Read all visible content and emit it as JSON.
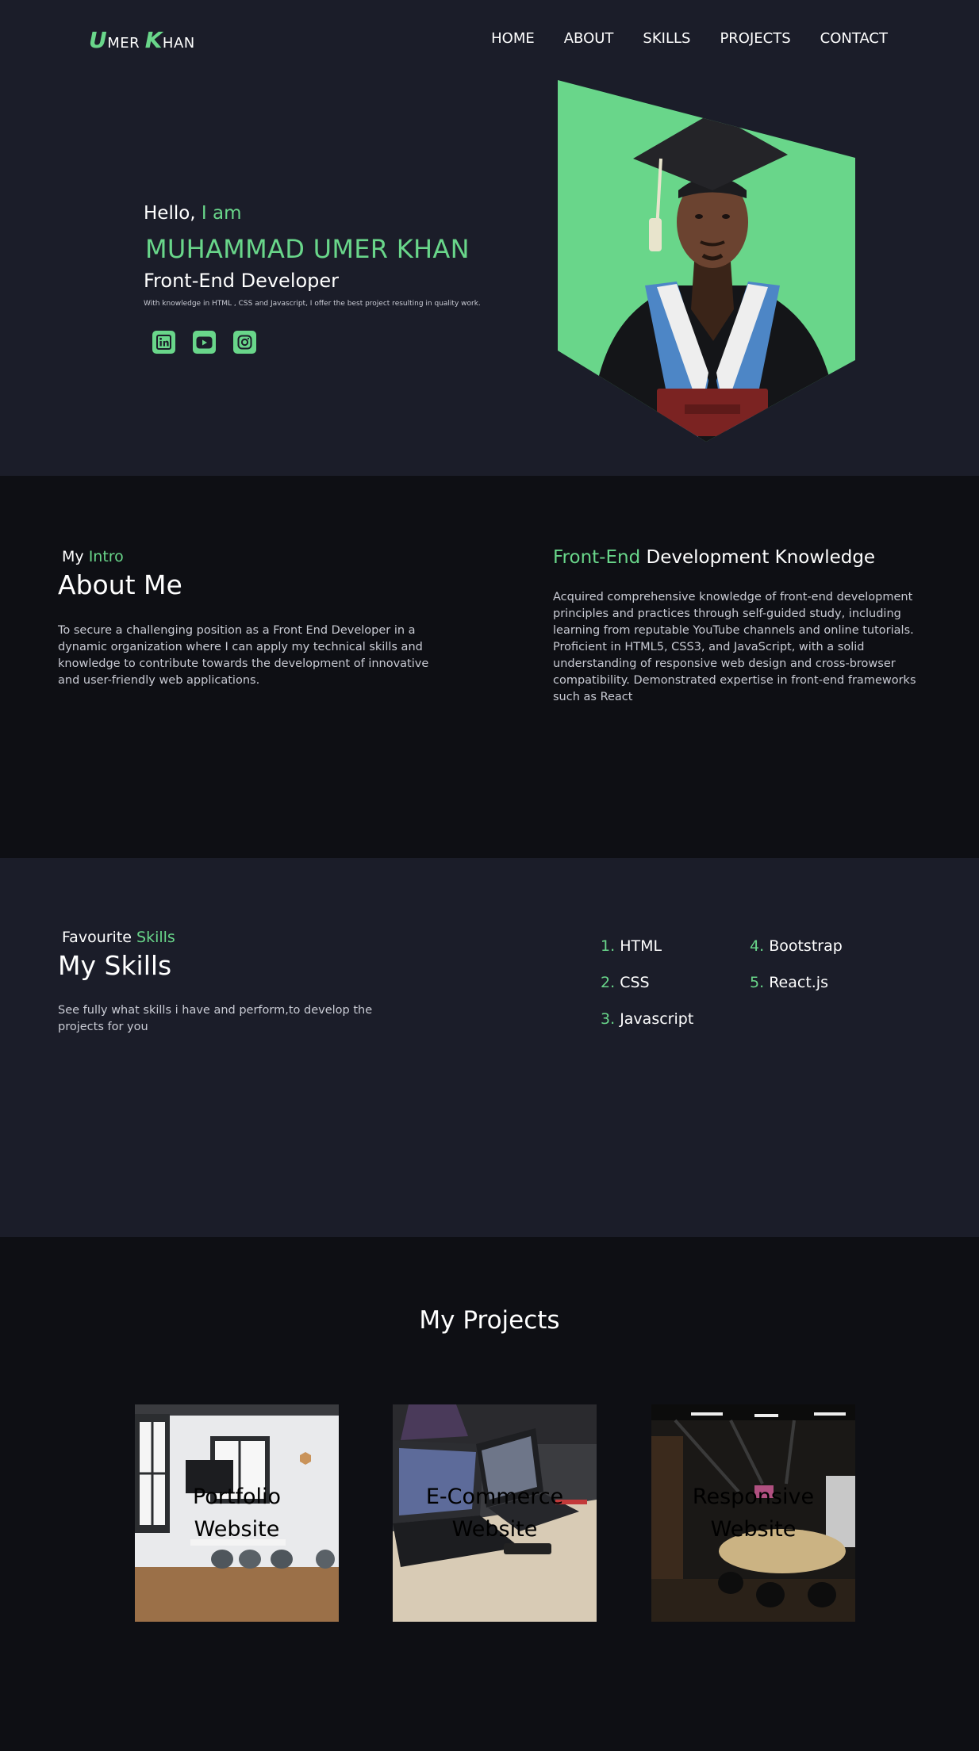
{
  "nav": {
    "logo": {
      "first_cap": "U",
      "first_rest": "MER",
      "second_cap": "K",
      "second_rest": "HAN"
    },
    "items": [
      {
        "label": "HOME"
      },
      {
        "label": "ABOUT"
      },
      {
        "label": "SKILLS"
      },
      {
        "label": "PROJECTS"
      },
      {
        "label": "CONTACT"
      }
    ]
  },
  "hero": {
    "hello": "Hello,",
    "iam": "I am",
    "name": "MUHAMMAD UMER KHAN",
    "role": "Front-End Developer",
    "blurb": "With knowledge in HTML , CSS and Javascript, I offer the best project resulting in quality work.",
    "socials": [
      {
        "icon": "linkedin-icon"
      },
      {
        "icon": "youtube-icon"
      },
      {
        "icon": "instagram-icon"
      }
    ]
  },
  "about": {
    "kicker_prefix": "My",
    "kicker_accent": "Intro",
    "title": "About Me",
    "body": "To secure a challenging position as a Front End Developer in a dynamic organization where I can apply my technical skills and knowledge to contribute towards the development of innovative and user-friendly web applications.",
    "knowledge_accent": "Front-End",
    "knowledge_rest": "Development Knowledge",
    "knowledge_body": "Acquired comprehensive knowledge of front-end development principles and practices through self-guided study, including learning from reputable YouTube channels and online tutorials. Proficient in HTML5, CSS3, and JavaScript, with a solid understanding of responsive web design and cross-browser compatibility. Demonstrated expertise in front-end frameworks such as React"
  },
  "skills": {
    "kicker_prefix": "Favourite",
    "kicker_accent": "Skills",
    "title": "My Skills",
    "body": "See fully what skills i have and perform,to develop the projects for you",
    "list": [
      {
        "num": "1.",
        "label": "HTML"
      },
      {
        "num": "2.",
        "label": "CSS"
      },
      {
        "num": "3.",
        "label": "Javascript"
      },
      {
        "num": "4.",
        "label": "Bootstrap"
      },
      {
        "num": "5.",
        "label": "React.js"
      }
    ]
  },
  "projects": {
    "title": "My Projects",
    "cards": [
      {
        "label": "Portfolio\nWebsite"
      },
      {
        "label": "E-Commerce\nWebsite"
      },
      {
        "label": "Responsive\nWebsite"
      }
    ]
  },
  "colors": {
    "accent": "#69d68a",
    "bg_dark": "#1b1d29",
    "bg_darker": "#0e0f14"
  }
}
